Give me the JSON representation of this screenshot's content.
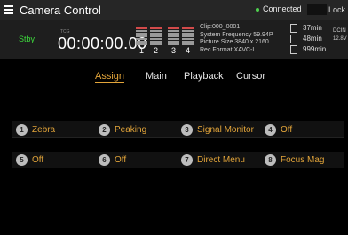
{
  "titlebar": {
    "title": "Camera Control",
    "connection_status": "Connected",
    "lock_label": "Lock"
  },
  "status": {
    "recording_state": "Stby",
    "timecode_label": "TCG",
    "timecode": "00:00:00.00",
    "audio_meter_channels": [
      "1",
      "2",
      "3",
      "4"
    ],
    "clip": "Clip:000_0001",
    "system_frequency": "System Frequency 59.94P",
    "picture_size": "Picture Size 3840 x 2160",
    "rec_format": "Rec Format XAVC-L",
    "media": [
      {
        "slot": "A",
        "remaining": "37min"
      },
      {
        "slot": "B",
        "remaining": "48min"
      },
      {
        "slot": "P",
        "remaining": "999min"
      }
    ],
    "power_source": "DCIN",
    "power_voltage": "12.8V"
  },
  "tabs": [
    {
      "label": "Assign",
      "active": true
    },
    {
      "label": "Main",
      "active": false
    },
    {
      "label": "Playback",
      "active": false
    },
    {
      "label": "Cursor",
      "active": false
    }
  ],
  "assign_rows": [
    [
      {
        "number": "1",
        "label": "Zebra"
      },
      {
        "number": "2",
        "label": "Peaking"
      },
      {
        "number": "3",
        "label": "Signal Monitor"
      },
      {
        "number": "4",
        "label": "Off"
      }
    ],
    [
      {
        "number": "5",
        "label": "Off"
      },
      {
        "number": "6",
        "label": "Off"
      },
      {
        "number": "7",
        "label": "Direct Menu"
      },
      {
        "number": "8",
        "label": "Focus Mag"
      }
    ]
  ],
  "colors": {
    "accent": "#e3a53a",
    "stby": "#3ddc3d",
    "connected_dot": "#4fd14f"
  }
}
